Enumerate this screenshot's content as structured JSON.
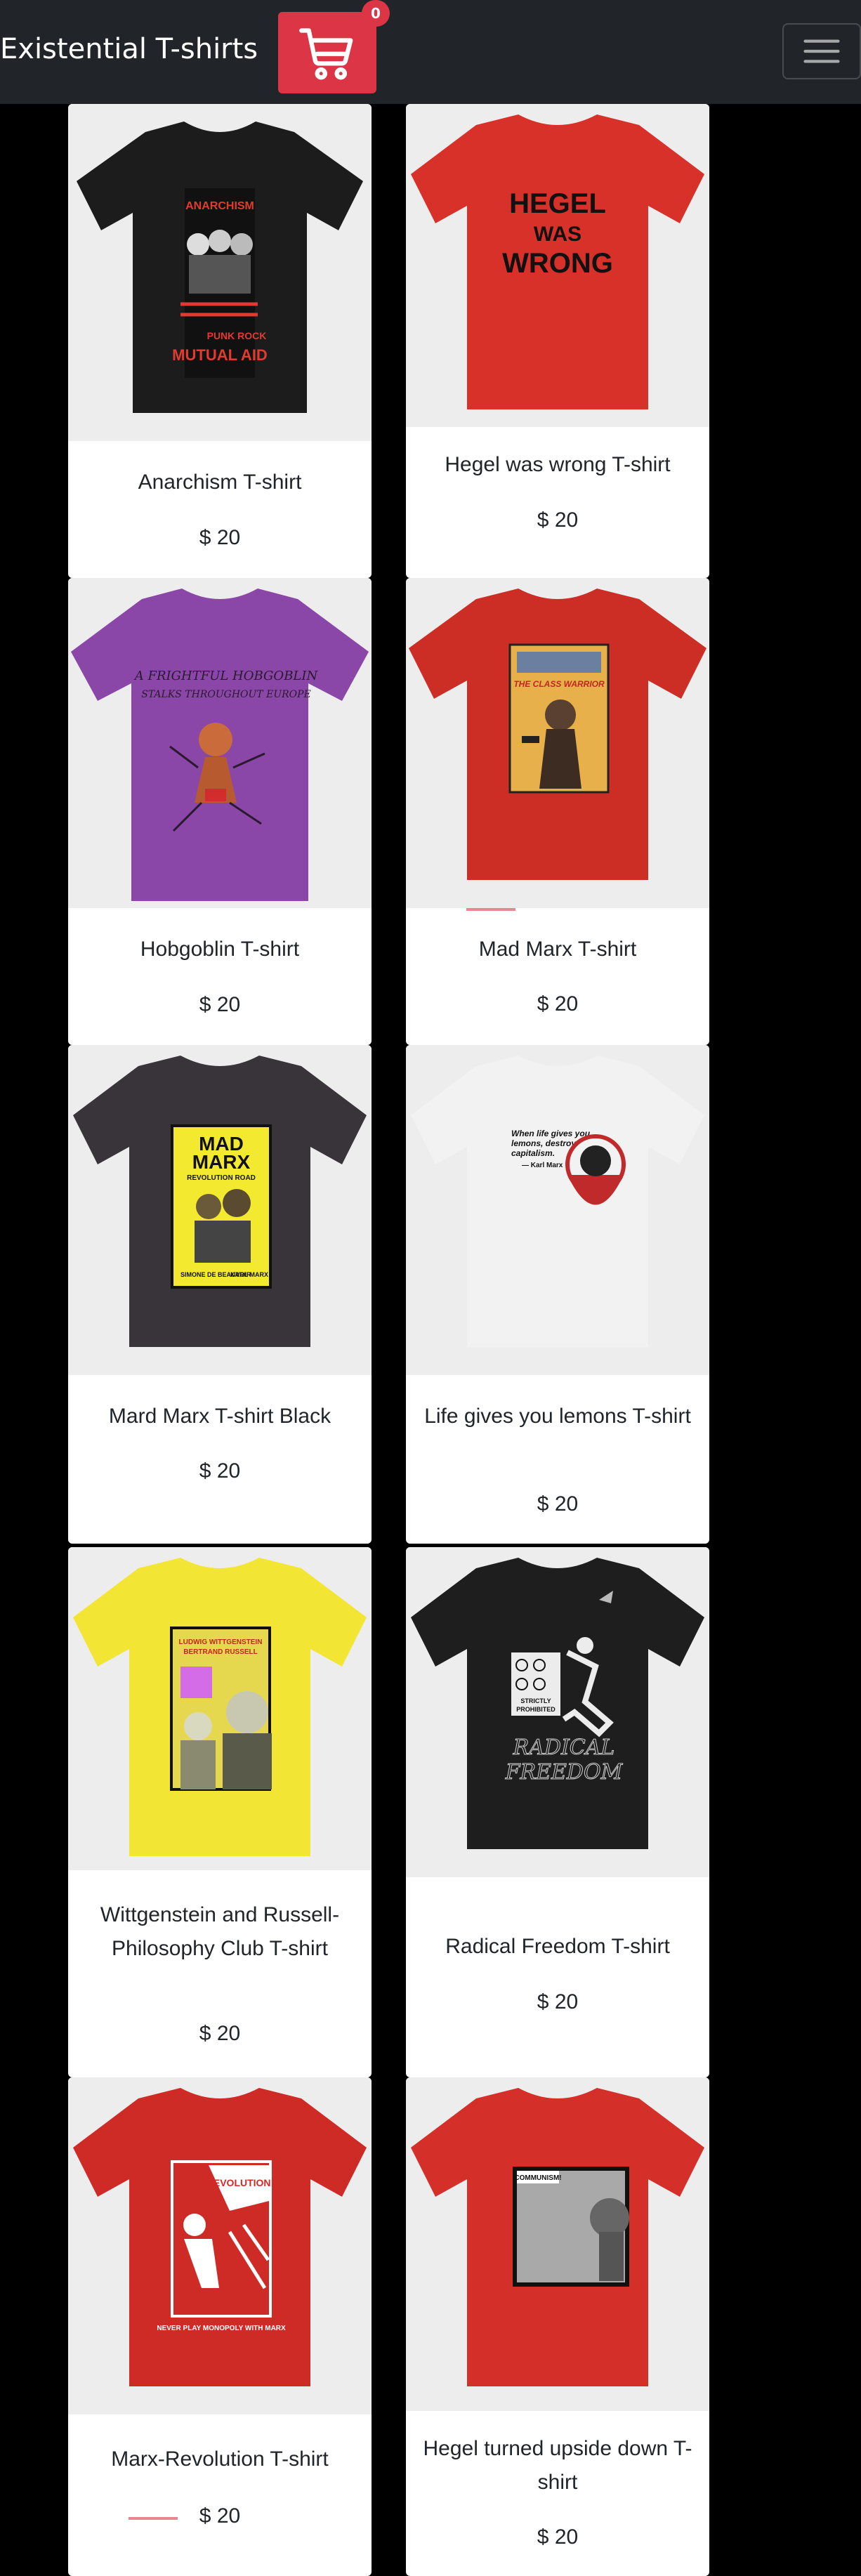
{
  "navbar": {
    "brand": "Existential T-shirts",
    "cart_count": "0",
    "cart_icon": "shopping-cart-icon",
    "menu_icon": "hamburger-menu-icon",
    "colors": {
      "bar": "#212529",
      "cart_button": "#dc3545"
    }
  },
  "products": [
    {
      "title": "Anarchism T-shirt",
      "price": "$ 20",
      "shirt_color": "#1c1c1c",
      "print": {
        "lines": [
          "ANARCHISM",
          "PUNK ROCK",
          "MUTUAL AID"
        ]
      }
    },
    {
      "title": "Hegel was wrong T-shirt",
      "price": "$ 20",
      "shirt_color": "#d7312a",
      "print": {
        "lines": [
          "HEGEL",
          "WAS",
          "WRONG"
        ]
      }
    },
    {
      "title": "Hobgoblin T-shirt",
      "price": "$ 20",
      "shirt_color": "#8b47a8",
      "print": {
        "lines": [
          "A FRIGHTFUL HOBGOBLIN",
          "STALKS THROUGHOUT EUROPE"
        ]
      }
    },
    {
      "title": "Mad Marx T-shirt",
      "price": "$ 20",
      "shirt_color": "#cc2d25",
      "print": {
        "lines": [
          "THE CLASS WARRIOR"
        ]
      }
    },
    {
      "title": "Mard Marx T-shirt Black",
      "price": "$ 20",
      "shirt_color": "#39333a",
      "print": {
        "lines": [
          "MAD",
          "MARX",
          "REVOLUTION ROAD",
          "SIMONE DE BEAUVOIR",
          "KARL MARX"
        ]
      }
    },
    {
      "title": "Life gives you lemons T-shirt",
      "price": "$ 20",
      "shirt_color": "#f2f2f2",
      "print": {
        "lines": [
          "When life gives you",
          "lemons, destroy",
          "capitalism.",
          "— Karl Marx"
        ]
      }
    },
    {
      "title": "Wittgenstein and Russell-Philosophy Club T-shirt",
      "price": "$ 20",
      "shirt_color": "#f2e533",
      "print": {
        "lines": [
          "LUDWIG WITTGENSTEIN",
          "BERTRAND RUSSELL"
        ]
      }
    },
    {
      "title": "Radical Freedom T-shirt",
      "price": "$ 20",
      "shirt_color": "#1e1e1e",
      "print": {
        "lines": [
          "STRICTLY",
          "PROHIBITED",
          "RADICAL",
          "FREEDOM"
        ]
      }
    },
    {
      "title": "Marx-Revolution T-shirt",
      "price": "$ 20",
      "shirt_color": "#cf2b26",
      "print": {
        "lines": [
          "REVOLUTION!",
          "NEVER PLAY MONOPOLY WITH MARX"
        ]
      }
    },
    {
      "title": "Hegel turned upside down T-shirt",
      "price": "$ 20",
      "shirt_color": "#d42f29",
      "print": {
        "lines": [
          "COMMUNISM!"
        ]
      }
    }
  ]
}
